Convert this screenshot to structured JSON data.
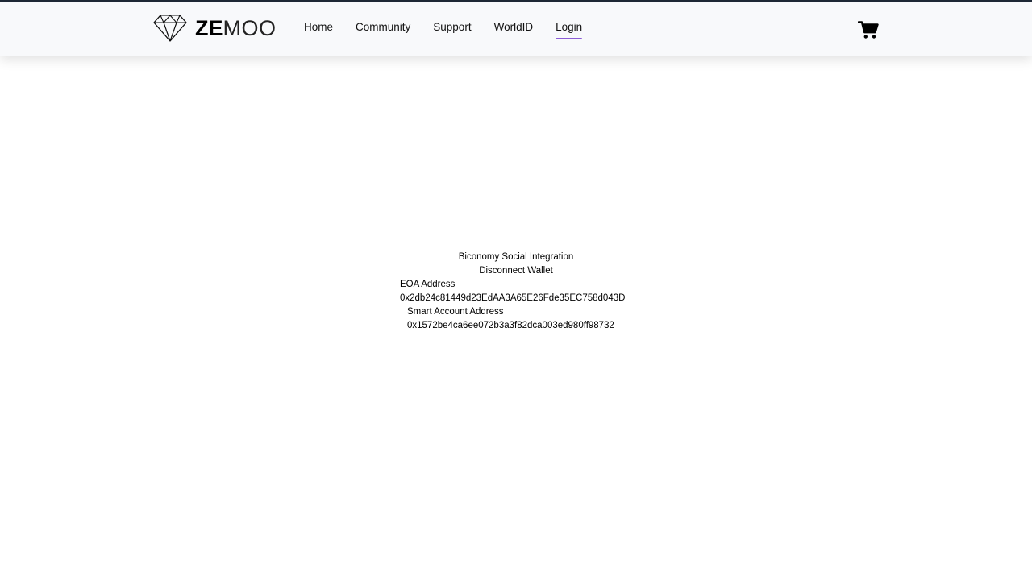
{
  "header": {
    "logo": {
      "bold": "ZE",
      "light": "MOO"
    },
    "nav": [
      {
        "label": "Home",
        "active": false
      },
      {
        "label": "Community",
        "active": false
      },
      {
        "label": "Support",
        "active": false
      },
      {
        "label": "WorldID",
        "active": false
      },
      {
        "label": "Login",
        "active": true
      }
    ],
    "cart_icon": "shopping-cart-icon",
    "active_underline_color": "#8b5cd6"
  },
  "main": {
    "title": "Biconomy Social Integration",
    "disconnect_label": "Disconnect Wallet",
    "eoa_label": "EOA Address",
    "eoa_value": "0x2db24c81449d23EdAA3A65E26Fde35EC758d043D",
    "smart_label": "Smart Account Address",
    "smart_value": "0x1572be4ca6ee072b3a3f82dca003ed980ff98732"
  }
}
